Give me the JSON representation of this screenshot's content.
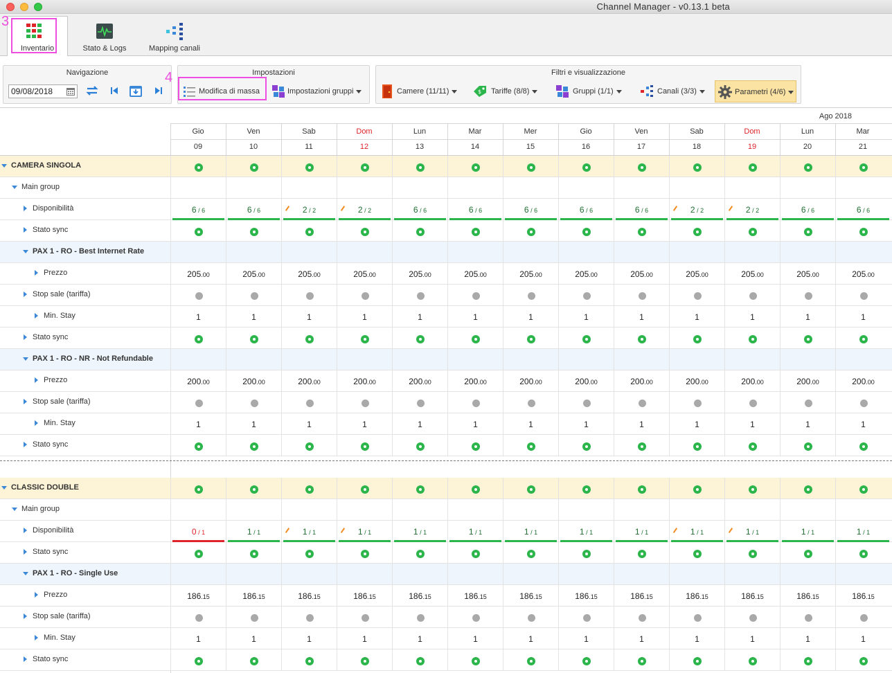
{
  "window": {
    "title": "Channel Manager - v0.13.1 beta"
  },
  "tabs": [
    {
      "label": "Inventario"
    },
    {
      "label": "Stato & Logs"
    },
    {
      "label": "Mapping canali"
    }
  ],
  "annotations": {
    "step3": "3",
    "step4": "4"
  },
  "toolbar": {
    "nav": {
      "title": "Navigazione",
      "date": "09/08/2018"
    },
    "settings": {
      "title": "Impostazioni",
      "mass_edit": "Modifica di massa",
      "group_settings": "Impostazioni gruppi"
    },
    "filters": {
      "title": "Filtri e visualizzazione",
      "rooms": "Camere (11/11)",
      "rates": "Tariffe (8/8)",
      "groups": "Gruppi (1/1)",
      "channels": "Canali (3/3)",
      "params": "Parametri (4/6)"
    }
  },
  "calendar": {
    "month": "Ago 2018",
    "days": [
      {
        "dow": "Gio",
        "num": "09"
      },
      {
        "dow": "Ven",
        "num": "10"
      },
      {
        "dow": "Sab",
        "num": "11"
      },
      {
        "dow": "Dom",
        "num": "12"
      },
      {
        "dow": "Lun",
        "num": "13"
      },
      {
        "dow": "Mar",
        "num": "14"
      },
      {
        "dow": "Mer",
        "num": "15"
      },
      {
        "dow": "Gio",
        "num": "16"
      },
      {
        "dow": "Ven",
        "num": "17"
      },
      {
        "dow": "Sab",
        "num": "18"
      },
      {
        "dow": "Dom",
        "num": "19"
      },
      {
        "dow": "Lun",
        "num": "20"
      },
      {
        "dow": "Mar",
        "num": "21"
      }
    ]
  },
  "rows": [
    {
      "type": "room",
      "label": "CAMERA SINGOLA",
      "cells": "ok"
    },
    {
      "type": "group",
      "label": "Main group",
      "cells": "empty"
    },
    {
      "type": "avail",
      "label": "Disponibilità",
      "values": [
        [
          "6",
          "6"
        ],
        [
          "6",
          "6"
        ],
        [
          "2",
          "2"
        ],
        [
          "2",
          "2"
        ],
        [
          "6",
          "6"
        ],
        [
          "6",
          "6"
        ],
        [
          "6",
          "6"
        ],
        [
          "6",
          "6"
        ],
        [
          "6",
          "6"
        ],
        [
          "2",
          "2"
        ],
        [
          "2",
          "2"
        ],
        [
          "6",
          "6"
        ],
        [
          "6",
          "6"
        ]
      ],
      "edited": [
        2,
        3,
        9,
        10
      ],
      "red": []
    },
    {
      "type": "sub",
      "label": "Stato sync",
      "cells": "ok"
    },
    {
      "type": "rate",
      "label": "PAX 1 - RO - Best Internet Rate",
      "cells": "empty"
    },
    {
      "type": "price",
      "label": "Prezzo",
      "int": "205",
      "dec": ".00"
    },
    {
      "type": "sub",
      "label": "Stop sale (tariffa)",
      "cells": "off"
    },
    {
      "type": "num",
      "label": "Min. Stay",
      "value": "1"
    },
    {
      "type": "sub",
      "label": "Stato sync",
      "cells": "ok"
    },
    {
      "type": "rate",
      "label": "PAX 1 - RO - NR - Not Refundable",
      "cells": "empty"
    },
    {
      "type": "price",
      "label": "Prezzo",
      "int": "200",
      "dec": ".00"
    },
    {
      "type": "sub",
      "label": "Stop sale (tariffa)",
      "cells": "off"
    },
    {
      "type": "num",
      "label": "Min. Stay",
      "value": "1"
    },
    {
      "type": "sub",
      "label": "Stato sync",
      "cells": "ok"
    },
    {
      "type": "spacer"
    },
    {
      "type": "room",
      "label": "CLASSIC DOUBLE",
      "cells": "ok"
    },
    {
      "type": "group",
      "label": "Main group",
      "cells": "empty"
    },
    {
      "type": "avail",
      "label": "Disponibilità",
      "values": [
        [
          "0",
          "1"
        ],
        [
          "1",
          "1"
        ],
        [
          "1",
          "1"
        ],
        [
          "1",
          "1"
        ],
        [
          "1",
          "1"
        ],
        [
          "1",
          "1"
        ],
        [
          "1",
          "1"
        ],
        [
          "1",
          "1"
        ],
        [
          "1",
          "1"
        ],
        [
          "1",
          "1"
        ],
        [
          "1",
          "1"
        ],
        [
          "1",
          "1"
        ],
        [
          "1",
          "1"
        ]
      ],
      "edited": [
        2,
        3,
        9,
        10
      ],
      "red": [
        0
      ]
    },
    {
      "type": "sub",
      "label": "Stato sync",
      "cells": "ok"
    },
    {
      "type": "rate",
      "label": "PAX 1 - RO - Single Use",
      "cells": "empty"
    },
    {
      "type": "price",
      "label": "Prezzo",
      "int": "186",
      "dec": ".15"
    },
    {
      "type": "sub",
      "label": "Stop sale (tariffa)",
      "cells": "off"
    },
    {
      "type": "num",
      "label": "Min. Stay",
      "value": "1"
    },
    {
      "type": "sub",
      "label": "Stato sync",
      "cells": "ok"
    }
  ],
  "colors": {
    "ok": "#2bb54a",
    "off": "#a9a9a9",
    "alert": "#e0242b",
    "room_bg": "#fdf3d6",
    "rate_bg": "#eef5fd",
    "highlight": "#ee4fe0"
  }
}
